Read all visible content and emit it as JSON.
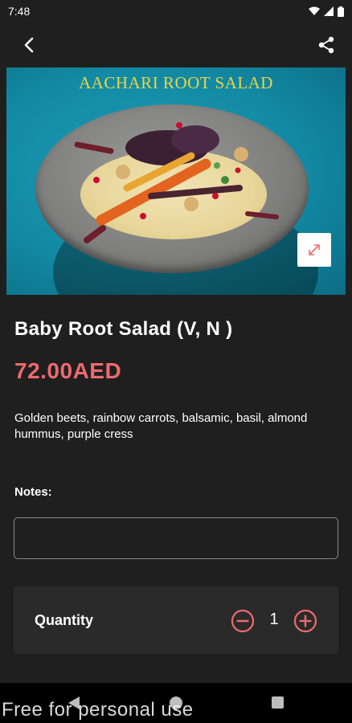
{
  "status_bar": {
    "time": "7:48",
    "icons": [
      "wifi-icon",
      "signal-icon",
      "battery-icon"
    ]
  },
  "app_bar": {
    "back_icon": "chevron-left-icon",
    "share_icon": "share-icon"
  },
  "hero": {
    "overlay_title": "AACHARI ROOT SALAD",
    "expand_icon": "expand-icon"
  },
  "item": {
    "title": "Baby Root Salad (V, N )",
    "price": "72.00AED",
    "description": "Golden beets, rainbow carrots, balsamic, basil, almond hummus, purple cress"
  },
  "notes": {
    "label": "Notes:",
    "value": "",
    "placeholder": ""
  },
  "quantity": {
    "label": "Quantity",
    "value": "1",
    "decrement_icon": "minus-circle-icon",
    "increment_icon": "plus-circle-icon"
  },
  "watermark": "Free for personal use",
  "colors": {
    "background": "#1f1f1f",
    "price": "#ec6a6f",
    "accent": "#ec6a6f",
    "hero_title": "#e8d54a",
    "panel": "#2a2a2a"
  }
}
